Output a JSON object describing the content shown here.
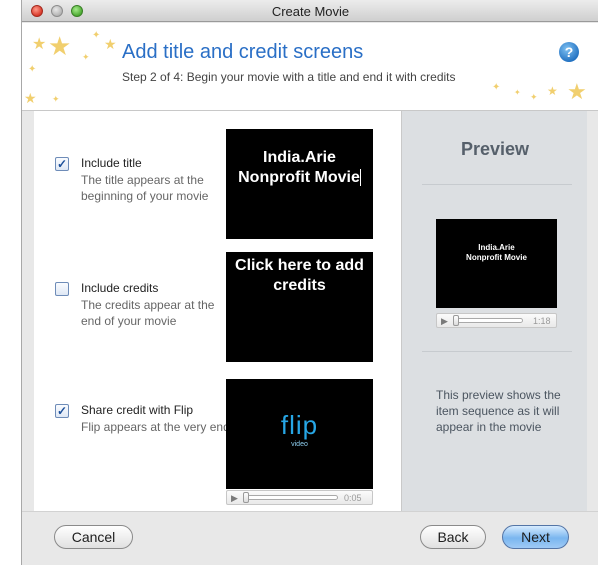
{
  "window": {
    "title": "Create Movie"
  },
  "header": {
    "title": "Add title and credit screens",
    "subtitle": "Step 2 of 4: Begin your movie with a title and end it with credits",
    "help_label": "?"
  },
  "options": [
    {
      "title": "Include title",
      "description": "The title appears at the beginning of your movie",
      "checked": true,
      "check_glyph": "✓"
    },
    {
      "title": "Include credits",
      "description": "The credits appear at the end of your movie",
      "checked": false,
      "check_glyph": ""
    },
    {
      "title": "Share credit with Flip",
      "description": "Flip appears at the very end",
      "checked": true,
      "check_glyph": "✓"
    }
  ],
  "thumbnails": {
    "title_line1": "India.Arie",
    "title_line2": "Nonprofit Movie",
    "credits_line1": "Click here to add",
    "credits_line2": "credits",
    "flip_logo": "flip",
    "flip_logo_sub": "video"
  },
  "flip_player": {
    "play_icon": "play-icon",
    "time": "0:05",
    "progress": 0
  },
  "preview": {
    "heading": "Preview",
    "thumb_line1": "India.Arie",
    "thumb_line2": "Nonprofit Movie",
    "time": "1:18",
    "progress": 0,
    "note": "This preview shows the item sequence as it will appear in the movie"
  },
  "footer": {
    "cancel_label": "Cancel",
    "back_label": "Back",
    "next_label": "Next"
  },
  "colors": {
    "accent": "#2a6fc6",
    "star": "#f1cf6e",
    "preview_panel": "#dcdfe2"
  }
}
